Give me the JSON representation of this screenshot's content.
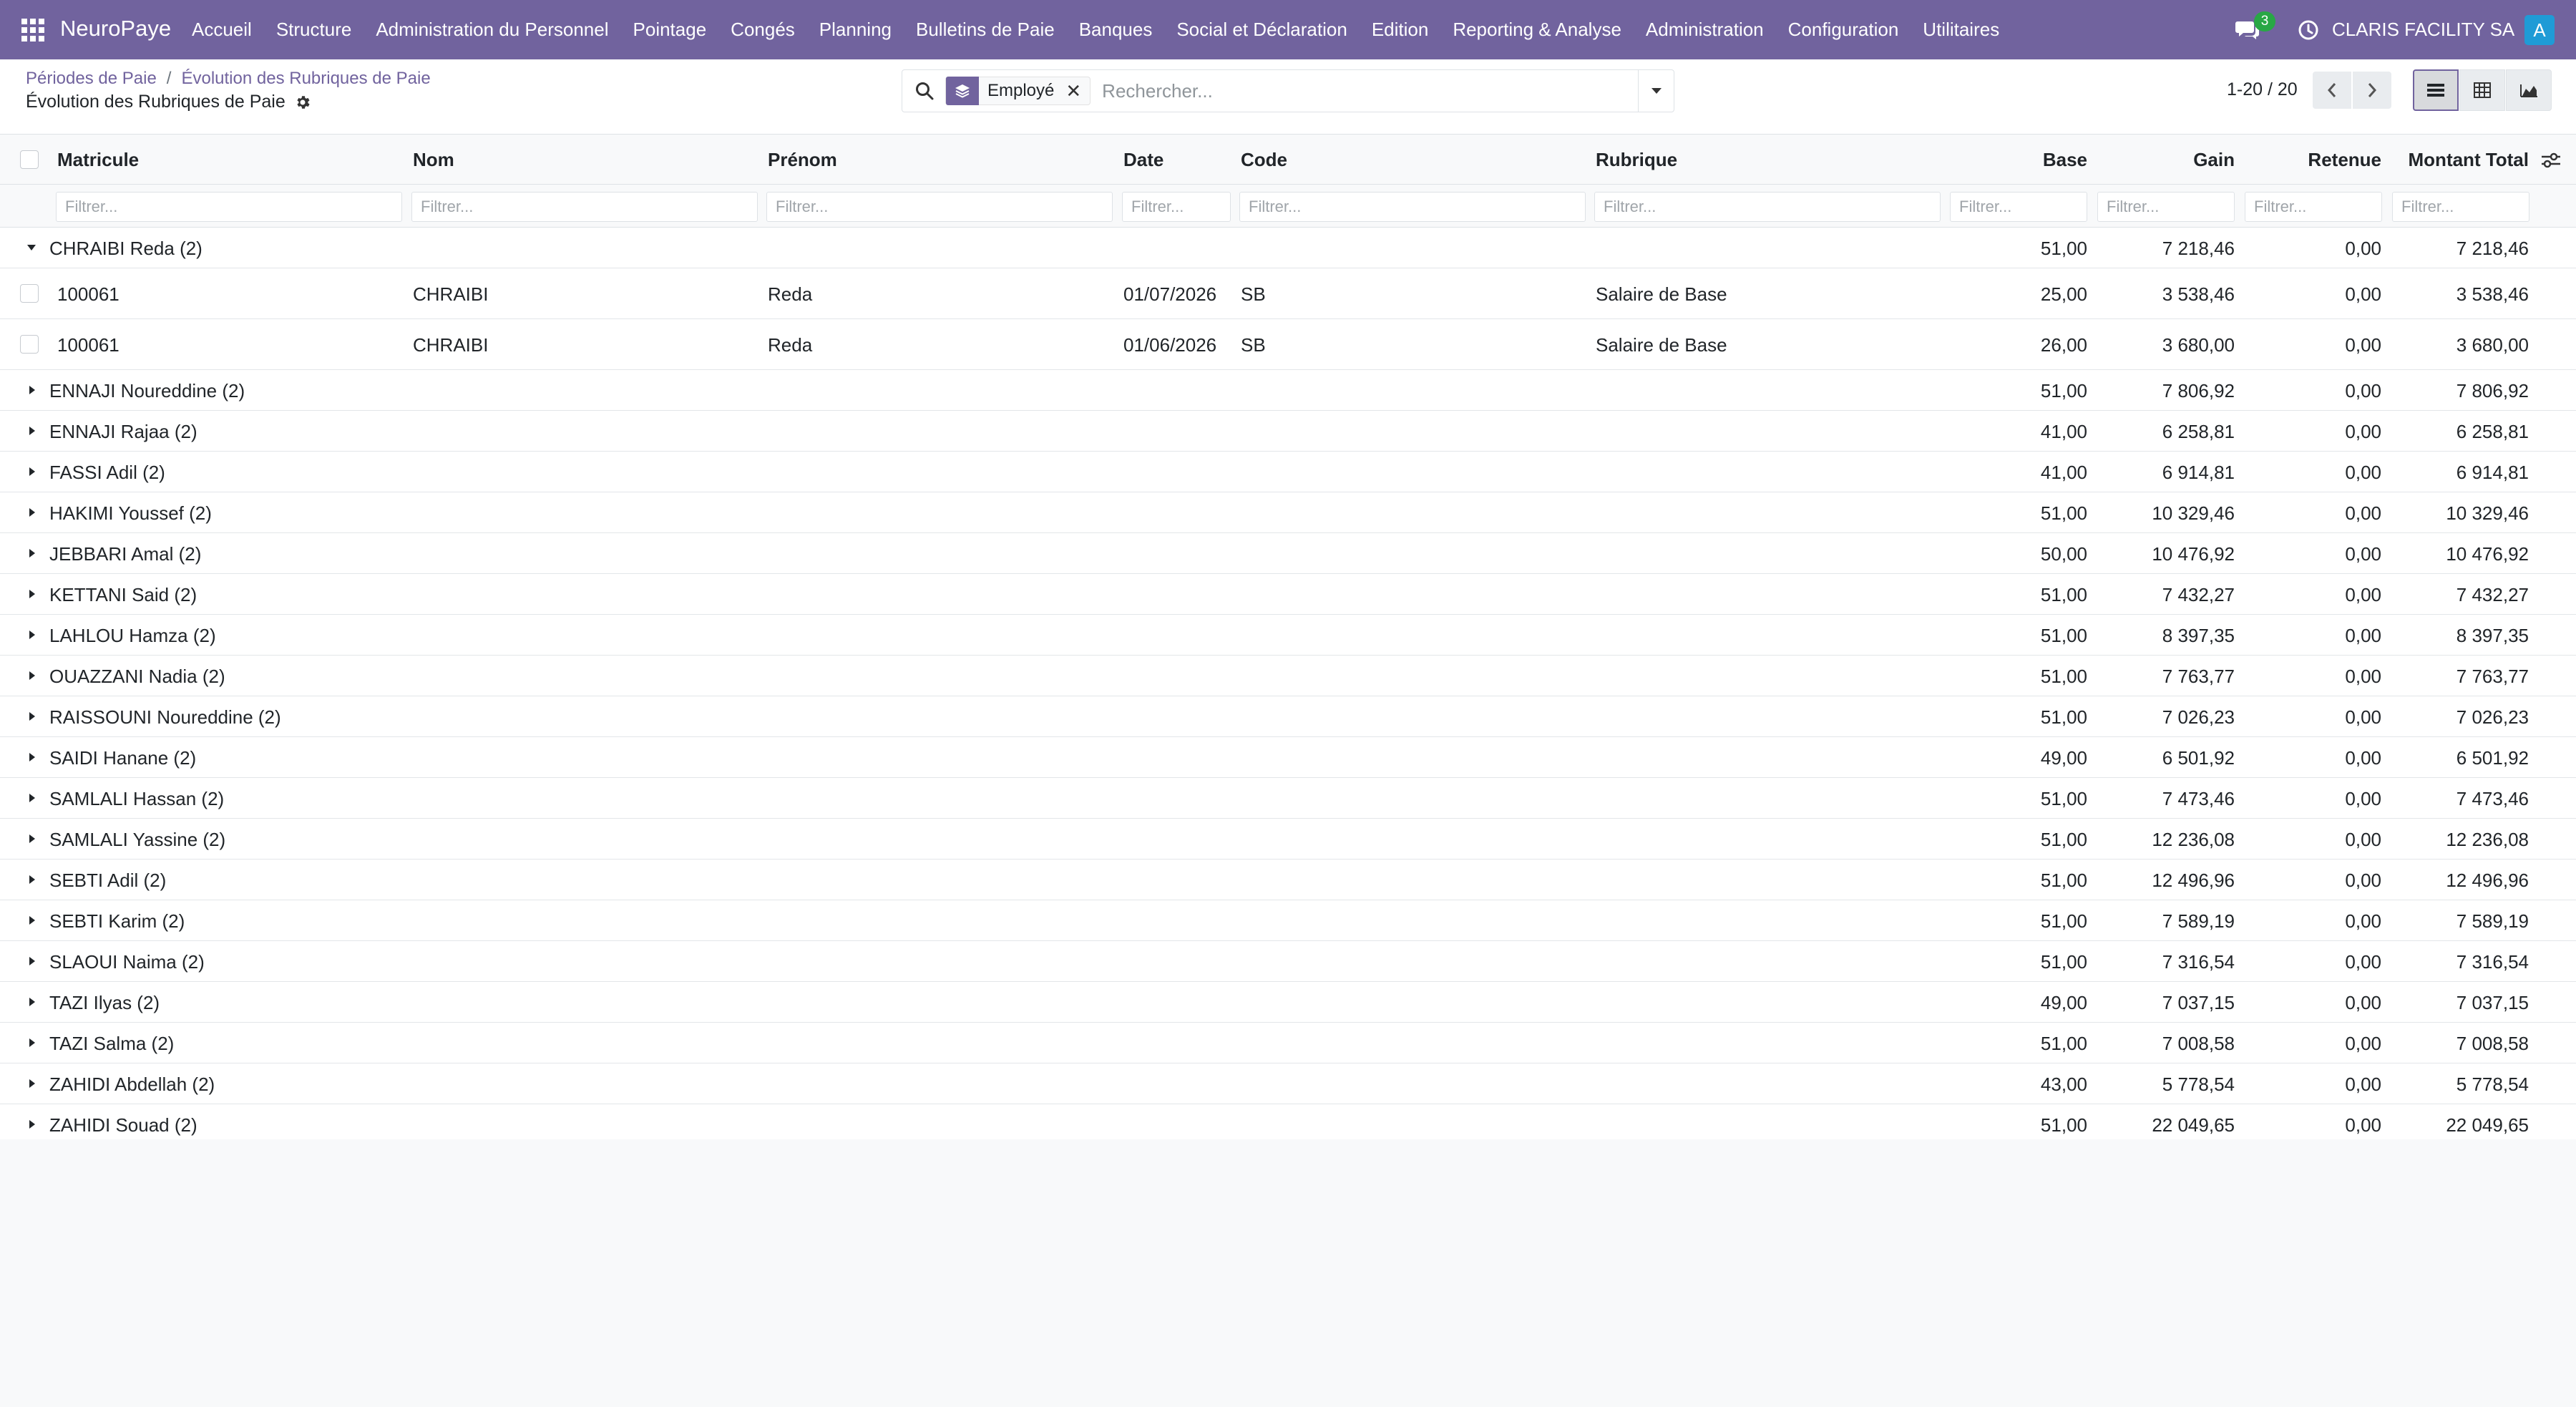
{
  "navbar": {
    "brand": "NeuroPaye",
    "menu": [
      "Accueil",
      "Structure",
      "Administration du Personnel",
      "Pointage",
      "Congés",
      "Planning",
      "Bulletins de Paie",
      "Banques",
      "Social et Déclaration",
      "Edition",
      "Reporting & Analyse",
      "Administration",
      "Configuration",
      "Utilitaires"
    ],
    "chat_badge": "3",
    "company": "CLARIS FACILITY SA",
    "avatar_letter": "A"
  },
  "breadcrumb": {
    "parent1": "Périodes de Paie",
    "separator": "/",
    "parent2": "Évolution des Rubriques de Paie",
    "current": "Évolution des Rubriques de Paie"
  },
  "search": {
    "facet_label": "Employé",
    "facet_remove": "✕",
    "placeholder": "Rechercher..."
  },
  "pager": {
    "value": "1-20 / 20"
  },
  "table": {
    "columns": {
      "matricule": "Matricule",
      "nom": "Nom",
      "prenom": "Prénom",
      "date": "Date",
      "code": "Code",
      "rubrique": "Rubrique",
      "base": "Base",
      "gain": "Gain",
      "retenue": "Retenue",
      "montant_total": "Montant Total"
    },
    "filter_placeholder": "Filtrer...",
    "expanded_group": {
      "label": "CHRAIBI Reda (2)",
      "base": "51,00",
      "gain": "7 218,46",
      "retenue": "0,00",
      "total": "7 218,46"
    },
    "records": [
      {
        "matricule": "100061",
        "nom": "CHRAIBI",
        "prenom": "Reda",
        "date": "01/07/2026",
        "code": "SB",
        "rubrique": "Salaire de Base",
        "base": "25,00",
        "gain": "3 538,46",
        "retenue": "0,00",
        "total": "3 538,46"
      },
      {
        "matricule": "100061",
        "nom": "CHRAIBI",
        "prenom": "Reda",
        "date": "01/06/2026",
        "code": "SB",
        "rubrique": "Salaire de Base",
        "base": "26,00",
        "gain": "3 680,00",
        "retenue": "0,00",
        "total": "3 680,00"
      }
    ],
    "groups": [
      {
        "label": "ENNAJI Noureddine (2)",
        "base": "51,00",
        "gain": "7 806,92",
        "retenue": "0,00",
        "total": "7 806,92"
      },
      {
        "label": "ENNAJI Rajaa (2)",
        "base": "41,00",
        "gain": "6 258,81",
        "retenue": "0,00",
        "total": "6 258,81"
      },
      {
        "label": "FASSI Adil (2)",
        "base": "41,00",
        "gain": "6 914,81",
        "retenue": "0,00",
        "total": "6 914,81"
      },
      {
        "label": "HAKIMI Youssef (2)",
        "base": "51,00",
        "gain": "10 329,46",
        "retenue": "0,00",
        "total": "10 329,46"
      },
      {
        "label": "JEBBARI Amal (2)",
        "base": "50,00",
        "gain": "10 476,92",
        "retenue": "0,00",
        "total": "10 476,92"
      },
      {
        "label": "KETTANI Said (2)",
        "base": "51,00",
        "gain": "7 432,27",
        "retenue": "0,00",
        "total": "7 432,27"
      },
      {
        "label": "LAHLOU Hamza (2)",
        "base": "51,00",
        "gain": "8 397,35",
        "retenue": "0,00",
        "total": "8 397,35"
      },
      {
        "label": "OUAZZANI Nadia (2)",
        "base": "51,00",
        "gain": "7 763,77",
        "retenue": "0,00",
        "total": "7 763,77"
      },
      {
        "label": "RAISSOUNI Noureddine (2)",
        "base": "51,00",
        "gain": "7 026,23",
        "retenue": "0,00",
        "total": "7 026,23"
      },
      {
        "label": "SAIDI Hanane (2)",
        "base": "49,00",
        "gain": "6 501,92",
        "retenue": "0,00",
        "total": "6 501,92"
      },
      {
        "label": "SAMLALI Hassan (2)",
        "base": "51,00",
        "gain": "7 473,46",
        "retenue": "0,00",
        "total": "7 473,46"
      },
      {
        "label": "SAMLALI Yassine (2)",
        "base": "51,00",
        "gain": "12 236,08",
        "retenue": "0,00",
        "total": "12 236,08"
      },
      {
        "label": "SEBTI Adil (2)",
        "base": "51,00",
        "gain": "12 496,96",
        "retenue": "0,00",
        "total": "12 496,96"
      },
      {
        "label": "SEBTI Karim (2)",
        "base": "51,00",
        "gain": "7 589,19",
        "retenue": "0,00",
        "total": "7 589,19"
      },
      {
        "label": "SLAOUI Naima (2)",
        "base": "51,00",
        "gain": "7 316,54",
        "retenue": "0,00",
        "total": "7 316,54"
      },
      {
        "label": "TAZI Ilyas (2)",
        "base": "49,00",
        "gain": "7 037,15",
        "retenue": "0,00",
        "total": "7 037,15"
      },
      {
        "label": "TAZI Salma (2)",
        "base": "51,00",
        "gain": "7 008,58",
        "retenue": "0,00",
        "total": "7 008,58"
      },
      {
        "label": "ZAHIDI Abdellah (2)",
        "base": "43,00",
        "gain": "5 778,54",
        "retenue": "0,00",
        "total": "5 778,54"
      },
      {
        "label": "ZAHIDI Souad (2)",
        "base": "51,00",
        "gain": "22 049,65",
        "retenue": "0,00",
        "total": "22 049,65"
      }
    ],
    "footer_dash": "—"
  },
  "icons": {
    "apps": "apps-grid-icon",
    "chat": "chat-icon",
    "clock": "clock-icon",
    "gear": "gear-icon",
    "search": "search-icon",
    "facet": "layers-icon",
    "caret_down": "caret-down-icon",
    "caret_right": "caret-right-icon",
    "settings_toggle": "sliders-icon"
  },
  "colors": {
    "brand": "#71639e",
    "badge": "#28a745",
    "avatar": "#1f9bd6"
  }
}
